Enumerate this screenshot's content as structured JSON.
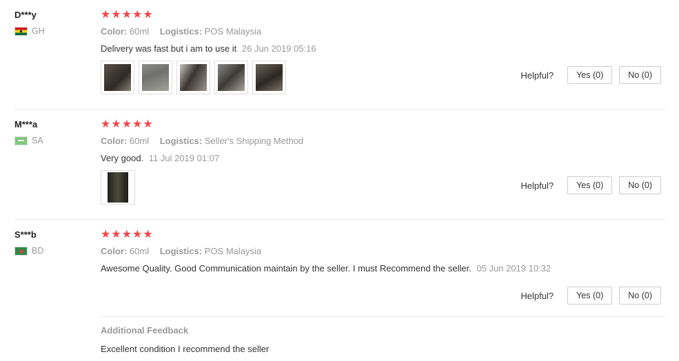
{
  "reviews": [
    {
      "user": "D***y",
      "country": "GH",
      "flag": "ghana-flag-icon",
      "stars": 5,
      "color_label": "Color:",
      "color_value": "60ml",
      "logistics_label": "Logistics:",
      "logistics_value": "POS Malaysia",
      "text": "Delivery was fast but i am to use it",
      "date": "26 Jun 2019 05:16",
      "images": 5,
      "helpful_label": "Helpful?",
      "yes_label": "Yes (0)",
      "no_label": "No (0)"
    },
    {
      "user": "M***a",
      "country": "SA",
      "flag": "saudi-arabia-flag-icon",
      "stars": 5,
      "color_label": "Color:",
      "color_value": "60ml",
      "logistics_label": "Logistics:",
      "logistics_value": "Seller's Shipping Method",
      "text": "Very good.",
      "date": "11 Jul 2019 01:07",
      "images": 1,
      "helpful_label": "Helpful?",
      "yes_label": "Yes (0)",
      "no_label": "No (0)"
    },
    {
      "user": "S***b",
      "country": "BD",
      "flag": "bangladesh-flag-icon",
      "stars": 5,
      "color_label": "Color:",
      "color_value": "60ml",
      "logistics_label": "Logistics:",
      "logistics_value": "POS Malaysia",
      "text": "Awesome Quality. Good Communication maintain by the seller. I must Recommend the seller.",
      "date": "05 Jun 2019 10:32",
      "images": 0,
      "helpful_label": "Helpful?",
      "yes_label": "Yes (0)",
      "no_label": "No (0)",
      "additional_title": "Additional Feedback",
      "additional_text": "Excellent condition I recommend the seller"
    }
  ],
  "colors": {
    "star": "#f0464a",
    "muted": "#999999",
    "text": "#333333"
  },
  "icons": {
    "star": "star-icon"
  }
}
